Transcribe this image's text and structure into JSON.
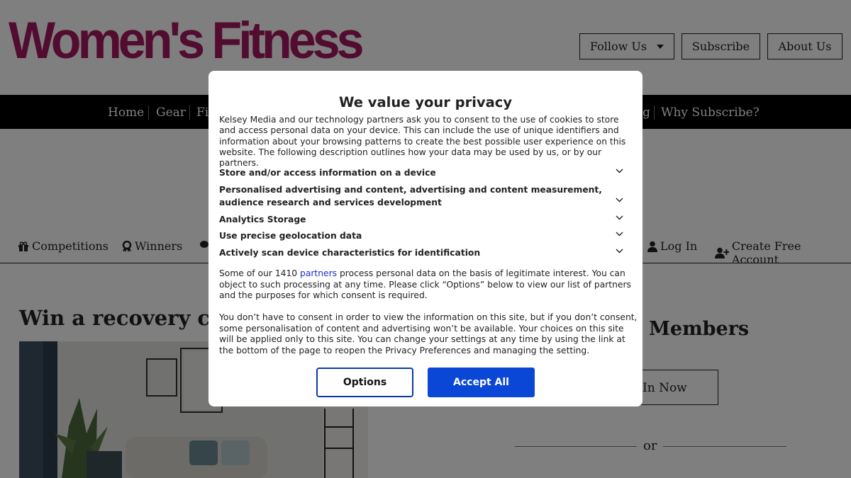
{
  "site": {
    "logo": "Women's Fitness",
    "header_buttons": {
      "follow": "Follow Us",
      "subscribe": "Subscribe",
      "about": "About Us"
    },
    "main_nav": {
      "home": "Home",
      "gear": "Gear",
      "fi": "Fi",
      "g": "g",
      "why": "Why Subscribe?"
    },
    "sub_nav": {
      "competitions": "Competitions",
      "winners": "Winners",
      "login": "Log In",
      "create": "Create Free Account"
    },
    "article_title": "Win a recovery com",
    "members_title": "Members",
    "login_box": "In Now",
    "or": "or"
  },
  "dialog": {
    "title": "We value your privacy",
    "intro": "Kelsey Media and our technology partners ask you to consent to the use of cookies to store and access personal data on your device. This can include the use of unique identifiers and information about your browsing patterns to create the best possible user experience on this website. The following description outlines how your data may be used by us, or by our partners.",
    "purposes": [
      "Store and/or access information on a device",
      "Personalised advertising and content, advertising and content measurement, audience research and services development",
      "Analytics Storage",
      "Use precise geolocation data",
      "Actively scan device characteristics for identification"
    ],
    "partners_pre": "Some of our 1410 ",
    "partners_link": "partners",
    "partners_post": " process personal data on the basis of legitimate interest. You can object to such processing at any time. Please click “Options” below to view our list of partners and the purposes for which consent is required.",
    "consent_text": "You don’t have to consent in order to view the information on this site, but if you don’t consent, some personalisation of content and advertising won’t be available. Your choices on this site will be applied only to this site. You can change your settings at any time by using the link at the bottom of the page to reopen the Privacy Preferences and managing the setting.",
    "options_label": "Options",
    "accept_label": "Accept All"
  },
  "colors": {
    "brand": "#a4195f",
    "accept": "#0b47d6",
    "options_border": "#0b3aa6",
    "link": "#1b2ec4"
  }
}
